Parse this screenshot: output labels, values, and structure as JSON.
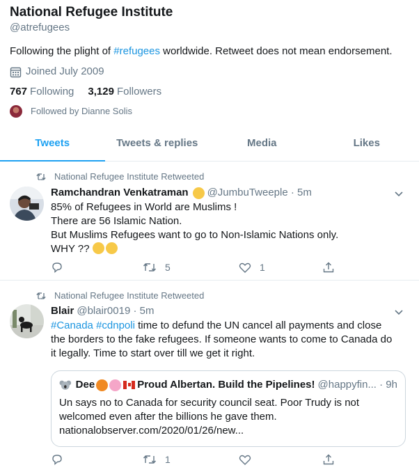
{
  "profile": {
    "name": "National Refugee Institute",
    "handle": "@atrefugees",
    "bio_before": "Following the plight of ",
    "bio_hashtag": "#refugees",
    "bio_after": " worldwide. Retweet does not mean endorsement.",
    "joined": "Joined July 2009",
    "following_count": "767",
    "following_label": "Following",
    "followers_count": "3,129",
    "followers_label": "Followers",
    "followed_by": "Followed by Dianne Solis"
  },
  "tabs": [
    "Tweets",
    "Tweets & replies",
    "Media",
    "Likes"
  ],
  "tweets": [
    {
      "retweet_label": "National Refugee Institute Retweeted",
      "author": "Ramchandran Venkatraman",
      "handle_time": "@JumbuTweeple · 5m",
      "lines": [
        "85% of Refugees in World are Muslims !",
        "There are 56 Islamic Nation.",
        "But Muslims Refugees want to go to Non-Islamic Nations only.",
        "WHY ??"
      ],
      "replies": "",
      "retweets": "5",
      "likes": "1"
    },
    {
      "retweet_label": "National Refugee Institute Retweeted",
      "author": "Blair",
      "handle_time": "@blair0019 · 5m",
      "hashtag1": "#Canada",
      "hashtag2": "#cdnpoli",
      "text": " time to defund the UN cancel all payments and close the borders to the fake refugees. If someone wants to come to Canada do it legally. Time to start over till we get it right.",
      "quote": {
        "author": "Dee      Proud Albertan. Build the Pipelines!",
        "author_prefix": "Dee",
        "author_suffix": "Proud Albertan. Build the Pipelines!",
        "meta": "@happyfin... · 9h",
        "text": "Un says no to Canada for security council seat. Poor Trudy is not welcomed even after the billions he gave them. nationalobserver.com/2020/01/26/new..."
      },
      "replies": "",
      "retweets": "1",
      "likes": ""
    }
  ],
  "colors": {
    "accent": "#1da1f2",
    "hashtag": "#1b95e0",
    "secondary_text": "#657786",
    "border": "#e6ecf0"
  }
}
